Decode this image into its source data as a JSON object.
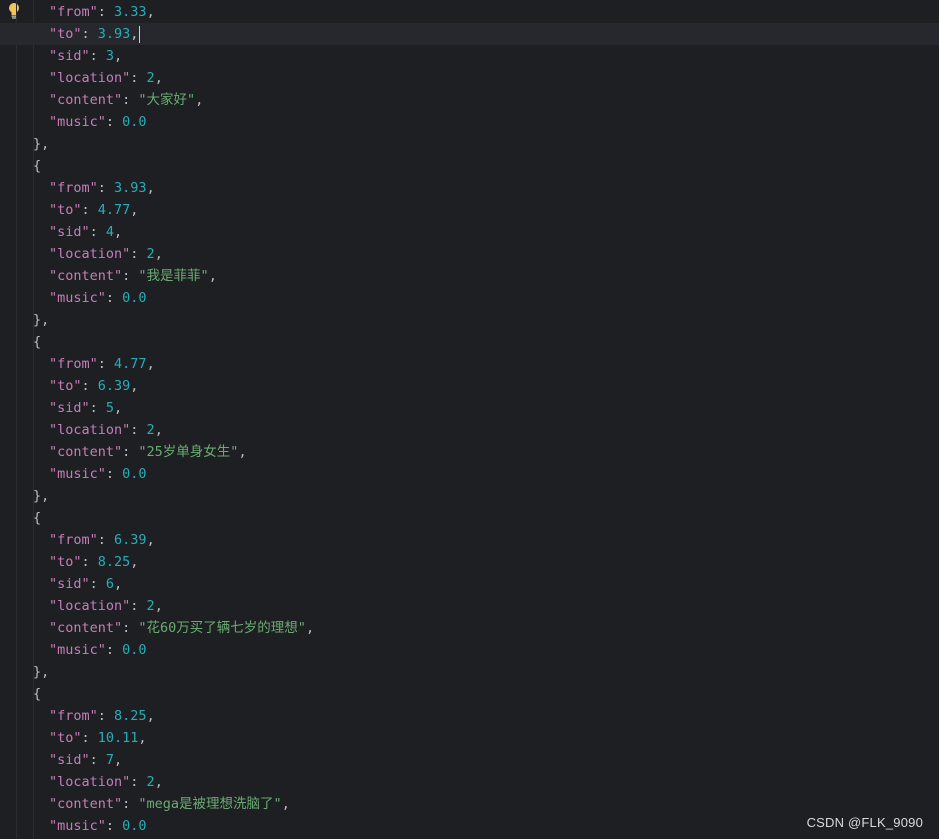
{
  "editor": {
    "lines": [
      {
        "t": "kv",
        "k": "\"from\"",
        "v": "3.33",
        "vt": "num",
        "comma": true
      },
      {
        "t": "kv",
        "k": "\"to\"",
        "v": "3.93",
        "vt": "num",
        "comma": true,
        "current": true
      },
      {
        "t": "kv",
        "k": "\"sid\"",
        "v": "3",
        "vt": "num",
        "comma": true
      },
      {
        "t": "kv",
        "k": "\"location\"",
        "v": "2",
        "vt": "num",
        "comma": true
      },
      {
        "t": "kv",
        "k": "\"content\"",
        "v": "\"大家好\"",
        "vt": "str",
        "comma": true
      },
      {
        "t": "kv",
        "k": "\"music\"",
        "v": "0.0",
        "vt": "num",
        "comma": false
      },
      {
        "t": "p",
        "v": "},"
      },
      {
        "t": "p",
        "v": "{"
      },
      {
        "t": "kv",
        "k": "\"from\"",
        "v": "3.93",
        "vt": "num",
        "comma": true
      },
      {
        "t": "kv",
        "k": "\"to\"",
        "v": "4.77",
        "vt": "num",
        "comma": true
      },
      {
        "t": "kv",
        "k": "\"sid\"",
        "v": "4",
        "vt": "num",
        "comma": true
      },
      {
        "t": "kv",
        "k": "\"location\"",
        "v": "2",
        "vt": "num",
        "comma": true
      },
      {
        "t": "kv",
        "k": "\"content\"",
        "v": "\"我是菲菲\"",
        "vt": "str",
        "comma": true
      },
      {
        "t": "kv",
        "k": "\"music\"",
        "v": "0.0",
        "vt": "num",
        "comma": false
      },
      {
        "t": "p",
        "v": "},"
      },
      {
        "t": "p",
        "v": "{"
      },
      {
        "t": "kv",
        "k": "\"from\"",
        "v": "4.77",
        "vt": "num",
        "comma": true
      },
      {
        "t": "kv",
        "k": "\"to\"",
        "v": "6.39",
        "vt": "num",
        "comma": true
      },
      {
        "t": "kv",
        "k": "\"sid\"",
        "v": "5",
        "vt": "num",
        "comma": true
      },
      {
        "t": "kv",
        "k": "\"location\"",
        "v": "2",
        "vt": "num",
        "comma": true
      },
      {
        "t": "kv",
        "k": "\"content\"",
        "v": "\"25岁单身女生\"",
        "vt": "str",
        "comma": true
      },
      {
        "t": "kv",
        "k": "\"music\"",
        "v": "0.0",
        "vt": "num",
        "comma": false
      },
      {
        "t": "p",
        "v": "},"
      },
      {
        "t": "p",
        "v": "{"
      },
      {
        "t": "kv",
        "k": "\"from\"",
        "v": "6.39",
        "vt": "num",
        "comma": true
      },
      {
        "t": "kv",
        "k": "\"to\"",
        "v": "8.25",
        "vt": "num",
        "comma": true
      },
      {
        "t": "kv",
        "k": "\"sid\"",
        "v": "6",
        "vt": "num",
        "comma": true
      },
      {
        "t": "kv",
        "k": "\"location\"",
        "v": "2",
        "vt": "num",
        "comma": true
      },
      {
        "t": "kv",
        "k": "\"content\"",
        "v": "\"花60万买了辆七岁的理想\"",
        "vt": "str",
        "comma": true
      },
      {
        "t": "kv",
        "k": "\"music\"",
        "v": "0.0",
        "vt": "num",
        "comma": false
      },
      {
        "t": "p",
        "v": "},"
      },
      {
        "t": "p",
        "v": "{"
      },
      {
        "t": "kv",
        "k": "\"from\"",
        "v": "8.25",
        "vt": "num",
        "comma": true
      },
      {
        "t": "kv",
        "k": "\"to\"",
        "v": "10.11",
        "vt": "num",
        "comma": true
      },
      {
        "t": "kv",
        "k": "\"sid\"",
        "v": "7",
        "vt": "num",
        "comma": true
      },
      {
        "t": "kv",
        "k": "\"location\"",
        "v": "2",
        "vt": "num",
        "comma": true
      },
      {
        "t": "kv",
        "k": "\"content\"",
        "v": "\"mega是被理想洗脑了\"",
        "vt": "str",
        "comma": true
      },
      {
        "t": "kv",
        "k": "\"music\"",
        "v": "0.0",
        "vt": "num",
        "comma": false
      }
    ]
  },
  "watermark": "CSDN @FLK_9090",
  "icons": {
    "gutter": "lightbulb-icon"
  },
  "colors": {
    "background": "#1e1f22",
    "key": "#c77dbb",
    "number": "#2aacb8",
    "string": "#6aab73",
    "punctuation": "#bcbec4",
    "current_line": "#26282e",
    "bulb": "#f2c55c"
  }
}
